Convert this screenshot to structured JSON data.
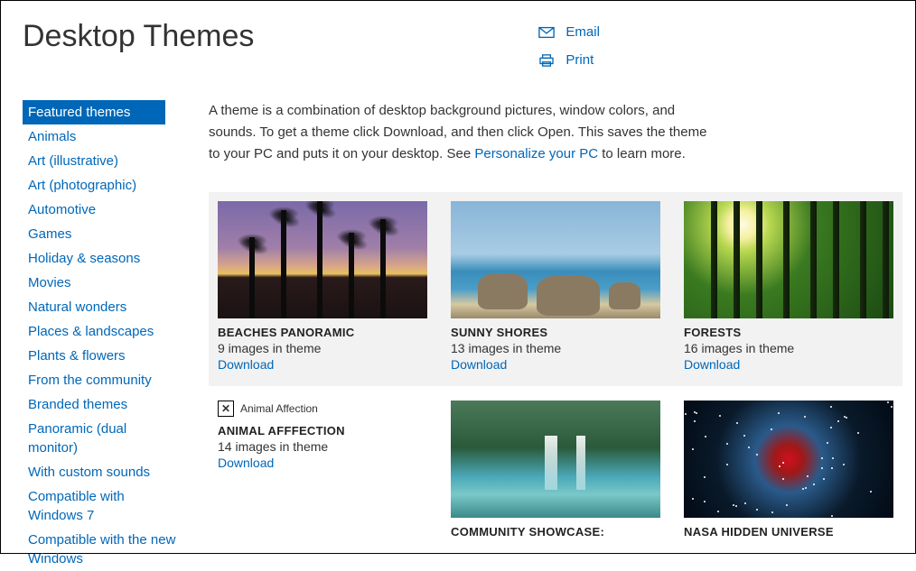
{
  "header": {
    "title": "Desktop Themes",
    "email": "Email",
    "print": "Print"
  },
  "sidebar": {
    "items": [
      {
        "label": "Featured themes",
        "selected": true
      },
      {
        "label": "Animals"
      },
      {
        "label": "Art (illustrative)"
      },
      {
        "label": "Art (photographic)"
      },
      {
        "label": "Automotive"
      },
      {
        "label": "Games"
      },
      {
        "label": "Holiday & seasons"
      },
      {
        "label": "Movies"
      },
      {
        "label": "Natural wonders"
      },
      {
        "label": "Places & landscapes"
      },
      {
        "label": "Plants & flowers"
      },
      {
        "label": "From the community"
      },
      {
        "label": "Branded themes"
      },
      {
        "label": "Panoramic (dual monitor)"
      },
      {
        "label": "With custom sounds"
      },
      {
        "label": "Compatible with Windows 7"
      },
      {
        "label": "Compatible with the new Windows"
      }
    ]
  },
  "intro": {
    "text_before_link": "A theme is a combination of desktop background pictures, window colors, and sounds. To get a theme click Download, and then click Open. This saves the theme to your PC and puts it on your desktop. See ",
    "link_text": "Personalize your PC",
    "text_after_link": " to learn more."
  },
  "themes_row1": [
    {
      "title": "BEACHES PANORAMIC",
      "count": "9 images in theme",
      "download": "Download",
      "thumb": "beach"
    },
    {
      "title": "SUNNY SHORES",
      "count": "13 images in theme",
      "download": "Download",
      "thumb": "sunny"
    },
    {
      "title": "FORESTS",
      "count": "16 images in theme",
      "download": "Download",
      "thumb": "forest"
    }
  ],
  "themes_row2": [
    {
      "title": "ANIMAL AFFFECTION",
      "count": "14 images in theme",
      "download": "Download",
      "thumb": "broken",
      "alt": "Animal Affection"
    },
    {
      "title": "COMMUNITY SHOWCASE:",
      "count": "",
      "download": "",
      "thumb": "waterfall"
    },
    {
      "title": "NASA HIDDEN UNIVERSE",
      "count": "",
      "download": "",
      "thumb": "nebula"
    }
  ]
}
